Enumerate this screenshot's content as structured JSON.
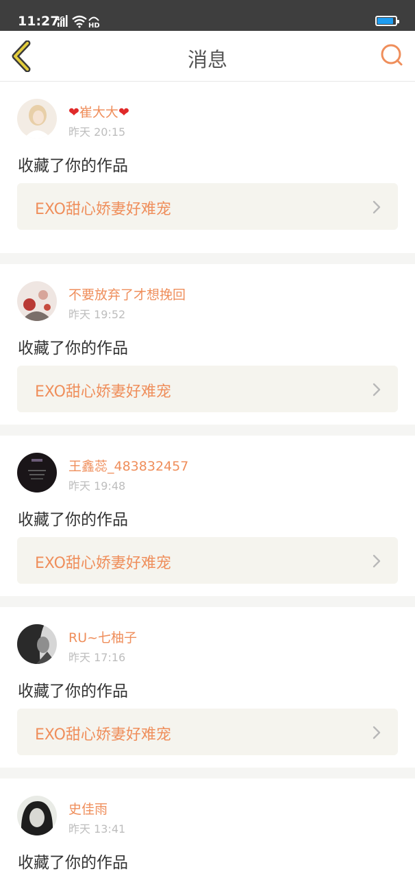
{
  "status_bar": {
    "time": "11:27",
    "network": "4G",
    "hd_label": "HD",
    "battery_level": 0.9,
    "battery_color": "#1e9cf0"
  },
  "nav": {
    "title": "消息",
    "back_icon": "chevron-left-icon",
    "search_icon": "search-icon"
  },
  "colors": {
    "accent": "#ef8e5b",
    "back_icon": "#d9c23a"
  },
  "messages": [
    {
      "user": "崔大大",
      "user_decorations": "❤",
      "time": "昨天 20:15",
      "action": "收藏了你的作品",
      "work_title": "EXO甜心娇妻好难宠"
    },
    {
      "user": "不要放弃了才想挽回",
      "time": "昨天 19:52",
      "action": "收藏了你的作品",
      "work_title": "EXO甜心娇妻好难宠"
    },
    {
      "user": "王鑫蕊_483832457",
      "time": "昨天 19:48",
      "action": "收藏了你的作品",
      "work_title": "EXO甜心娇妻好难宠"
    },
    {
      "user": "RU~七柚子",
      "time": "昨天 17:16",
      "action": "收藏了你的作品",
      "work_title": "EXO甜心娇妻好难宠"
    },
    {
      "user": "史佳雨",
      "time": "昨天 13:41",
      "action": "收藏了你的作品"
    }
  ]
}
